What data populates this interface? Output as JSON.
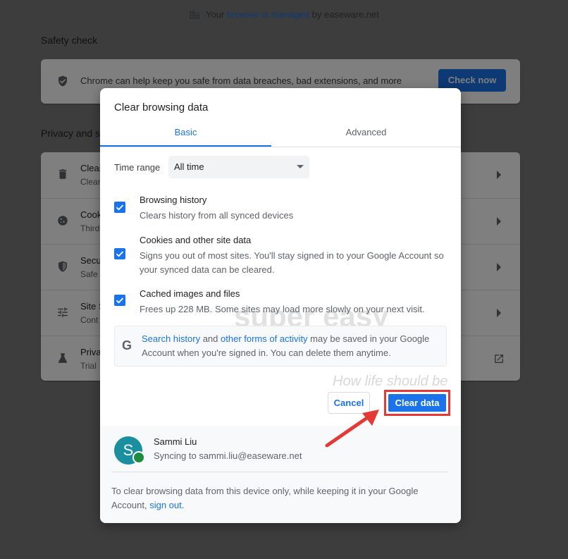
{
  "managed": {
    "prefix": "Your ",
    "link": "browser is managed",
    "suffix": " by easeware.net"
  },
  "safety": {
    "title": "Safety check",
    "text": "Chrome can help keep you safe from data breaches, bad extensions, and more",
    "button": "Check now"
  },
  "privacy": {
    "title": "Privacy and s",
    "rows": [
      {
        "title": "Clear",
        "sub": "Clear",
        "icon": "trash-icon"
      },
      {
        "title": "Cook",
        "sub": "Third",
        "icon": "cookie-icon"
      },
      {
        "title": "Secu",
        "sub": "Safe",
        "icon": "shield-icon"
      },
      {
        "title": "Site S",
        "sub": "Cont",
        "icon": "sliders-icon"
      },
      {
        "title": "Priva",
        "sub": "Trial",
        "icon": "flask-icon"
      }
    ]
  },
  "dialog": {
    "title": "Clear browsing data",
    "tabs": {
      "basic": "Basic",
      "advanced": "Advanced"
    },
    "time_range": {
      "label": "Time range",
      "value": "All time"
    },
    "options": [
      {
        "title": "Browsing history",
        "desc": "Clears history from all synced devices",
        "checked": true
      },
      {
        "title": "Cookies and other site data",
        "desc": "Signs you out of most sites. You'll stay signed in to your Google Account so your synced data can be cleared.",
        "checked": true
      },
      {
        "title": "Cached images and files",
        "desc": "Frees up 228 MB. Some sites may load more slowly on your next visit.",
        "checked": true
      }
    ],
    "google_note": {
      "icon": "G",
      "link1": "Search history",
      "and": " and ",
      "link2": "other forms of activity",
      "rest": " may be saved in your Google Account when you're signed in. You can delete them anytime."
    },
    "buttons": {
      "cancel": "Cancel",
      "clear": "Clear data"
    },
    "account": {
      "initial": "S",
      "name": "Sammi Liu",
      "sync": "Syncing to sammi.liu@easeware.net",
      "note": "To clear browsing data from this device only, while keeping it in your Google Account, ",
      "note_link": "sign out",
      "note_end": "."
    }
  },
  "watermark": {
    "brand": "super easy",
    "tagline": "How life should be"
  },
  "colors": {
    "accent": "#1a73e8",
    "highlight": "#e53935"
  }
}
